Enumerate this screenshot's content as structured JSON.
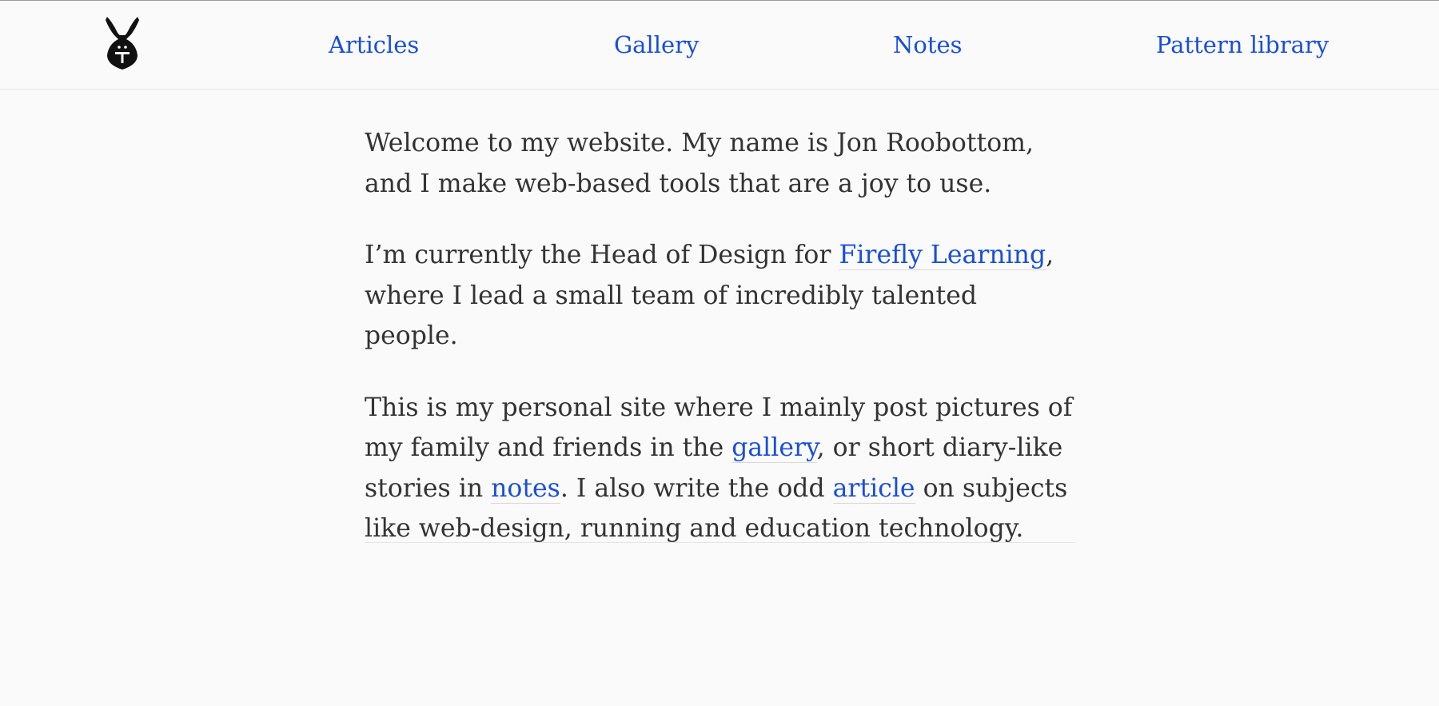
{
  "header": {
    "logo_icon": "rabbit-logo-icon",
    "nav": {
      "articles": "Articles",
      "gallery": "Gallery",
      "notes": "Notes",
      "pattern_library": "Pattern library"
    }
  },
  "intro": {
    "p1": "Welcome to my website. My name is Jon Roobottom, and I make web-based tools that are a joy to use.",
    "p2_before": "I’m currently the Head of Design for ",
    "p2_link": "Firefly Learning",
    "p2_after": ", where I lead a small team of incredibly talented people.",
    "p3_part1": "This is my personal site where I mainly post pictures of my family and friends in the ",
    "p3_link_gallery": "gallery",
    "p3_part2": ", or short diary-like stories in ",
    "p3_link_notes": "notes",
    "p3_part3": ". I also write the odd ",
    "p3_link_article": "article",
    "p3_part4": " on subjects like web-design, running and education technology."
  },
  "colors": {
    "link": "#1a4fd6",
    "text": "#333333",
    "background": "#fafafa",
    "rule": "#e4e4e4"
  }
}
